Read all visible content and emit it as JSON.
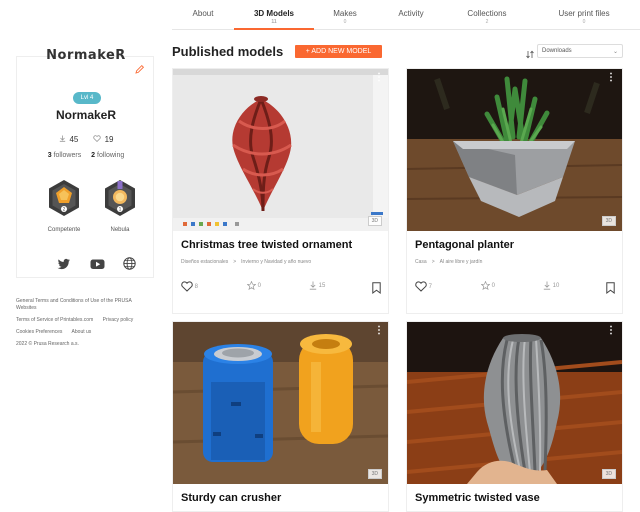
{
  "tabs": [
    {
      "label": "About",
      "count": ""
    },
    {
      "label": "3D Models",
      "count": "11"
    },
    {
      "label": "Makes",
      "count": "0"
    },
    {
      "label": "Activity",
      "count": ""
    },
    {
      "label": "Collections",
      "count": "2"
    },
    {
      "label": "User print files",
      "count": "0"
    }
  ],
  "profile": {
    "logo_text": "NormakeR",
    "level": "Lvl 4",
    "name": "NormakeR",
    "downloads": "45",
    "likes": "19",
    "followers_count": "3",
    "followers_label": "followers",
    "following_count": "2",
    "following_label": "following",
    "badges": [
      {
        "label": "Competente",
        "color": "#f0a02b"
      },
      {
        "label": "Nebula",
        "color": "#f3b95f"
      }
    ],
    "socials": [
      "twitter-icon",
      "youtube-icon",
      "globe-icon"
    ]
  },
  "footer": {
    "terms_general": "General Terms and Conditions of Use of the PRUSA Websites",
    "terms_service": "Terms of Service of Printables.com",
    "privacy": "Privacy policy",
    "cookies": "Cookies Preferences",
    "about": "About us",
    "copyright": "2022 © Prusa Research a.s."
  },
  "main": {
    "title": "Published models",
    "add_button": "+ ADD NEW MODEL",
    "sort_value": "Downloads"
  },
  "accent_color": "#fa6831",
  "models": [
    {
      "title": "Christmas tree twisted ornament",
      "category": "Diseños estacionales",
      "subcategory": "Invierno y Navidad y año nuevo",
      "likes": "8",
      "makes": "0",
      "downloads": "15",
      "tag": "3D"
    },
    {
      "title": "Pentagonal planter",
      "category": "Casa",
      "subcategory": "Al aire libre y jardín",
      "likes": "7",
      "makes": "0",
      "downloads": "10",
      "tag": "3D"
    },
    {
      "title": "Sturdy can crusher",
      "tag": "3D"
    },
    {
      "title": "Symmetric twisted vase",
      "tag": "3D"
    }
  ]
}
